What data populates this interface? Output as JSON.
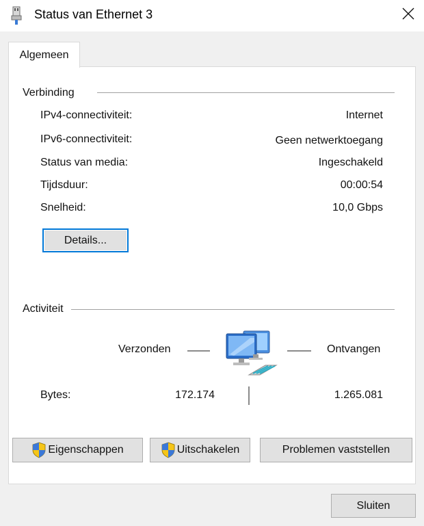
{
  "window": {
    "title": "Status van Ethernet 3",
    "icon": "network-adapter-icon",
    "close_icon": "close-icon"
  },
  "tabs": [
    {
      "label": "Algemeen",
      "active": true
    }
  ],
  "connection": {
    "group_title": "Verbinding",
    "rows": [
      {
        "label": "IPv4-connectiviteit:",
        "value": "Internet"
      },
      {
        "label": "IPv6-connectiviteit:",
        "value": "Geen netwerktoegang"
      },
      {
        "label": "Status van media:",
        "value": "Ingeschakeld"
      },
      {
        "label": "Tijdsduur:",
        "value": "00:00:54"
      },
      {
        "label": "Snelheid:",
        "value": "10,0 Gbps"
      }
    ],
    "details_button": "Details..."
  },
  "activity": {
    "group_title": "Activiteit",
    "sent_label": "Verzonden",
    "received_label": "Ontvangen",
    "bytes_label": "Bytes:",
    "bytes_sent": "172.174",
    "bytes_received": "1.265.081",
    "icon": "network-computers-icon"
  },
  "buttons": {
    "properties": "Eigenschappen",
    "disable": "Uitschakelen",
    "diagnose": "Problemen vaststellen",
    "close": "Sluiten",
    "shield_icon": "uac-shield-icon"
  },
  "colors": {
    "focus_border": "#0078d7",
    "button_face": "#e1e1e1",
    "dialog_bg": "#f0f0f0"
  }
}
